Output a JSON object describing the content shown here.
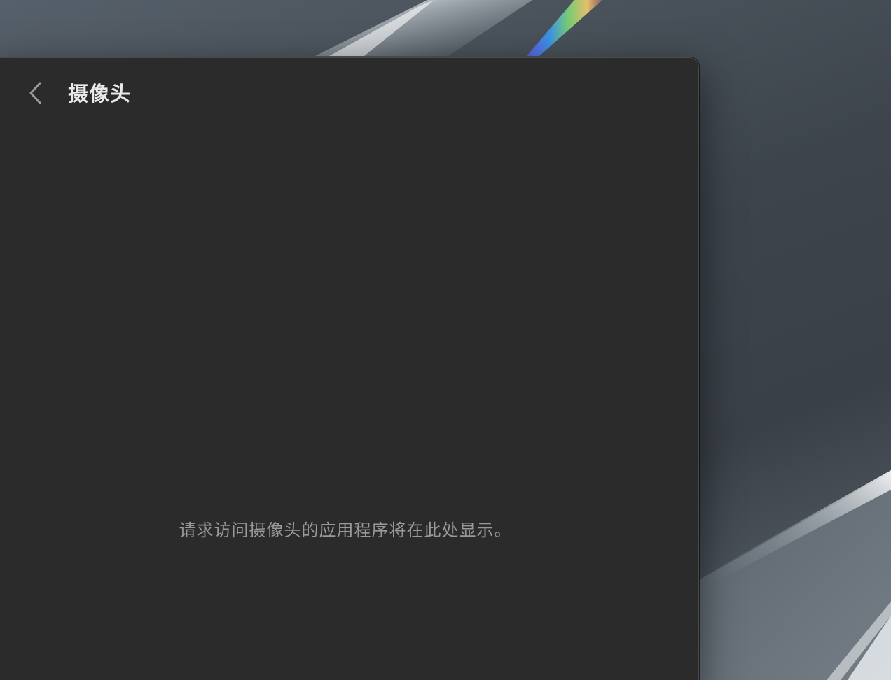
{
  "window": {
    "title": "摄像头",
    "back_icon": "chevron-left-icon"
  },
  "content": {
    "empty_message": "请求访问摄像头的应用程序将在此处显示。"
  },
  "colors": {
    "window_background": "#2b2b2b",
    "title_text": "#e9e9e9",
    "secondary_text": "#9a9a9a",
    "back_chevron": "#9c9c9c"
  }
}
